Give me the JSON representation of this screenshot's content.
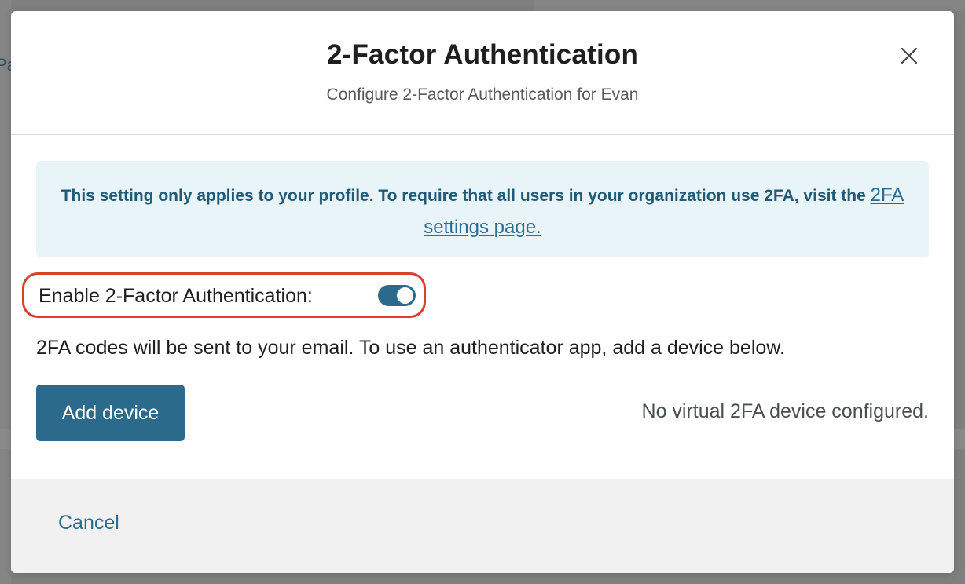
{
  "background": {
    "peek_text": "Pa"
  },
  "modal": {
    "title": "2-Factor Authentication",
    "subtitle": "Configure 2-Factor Authentication for Evan",
    "close_icon": "close-icon",
    "notice": {
      "text_before_link": "This setting only applies to your profile. To require that all users in your organization use 2FA, visit the ",
      "link_text": "2FA settings page."
    },
    "toggle": {
      "label": "Enable 2-Factor Authentication:",
      "state": "on"
    },
    "info_text": "2FA codes will be sent to your email. To use an authenticator app, add a device below.",
    "add_device_label": "Add device",
    "device_status": "No virtual 2FA device configured.",
    "cancel_label": "Cancel"
  },
  "colors": {
    "primary": "#2b6a8a",
    "notice_bg": "#e9f4f9",
    "notice_text": "#1f5a78",
    "highlight_border": "#d9412d",
    "footer_bg": "#f1f1f2",
    "overlay": "#7f7f7f"
  }
}
